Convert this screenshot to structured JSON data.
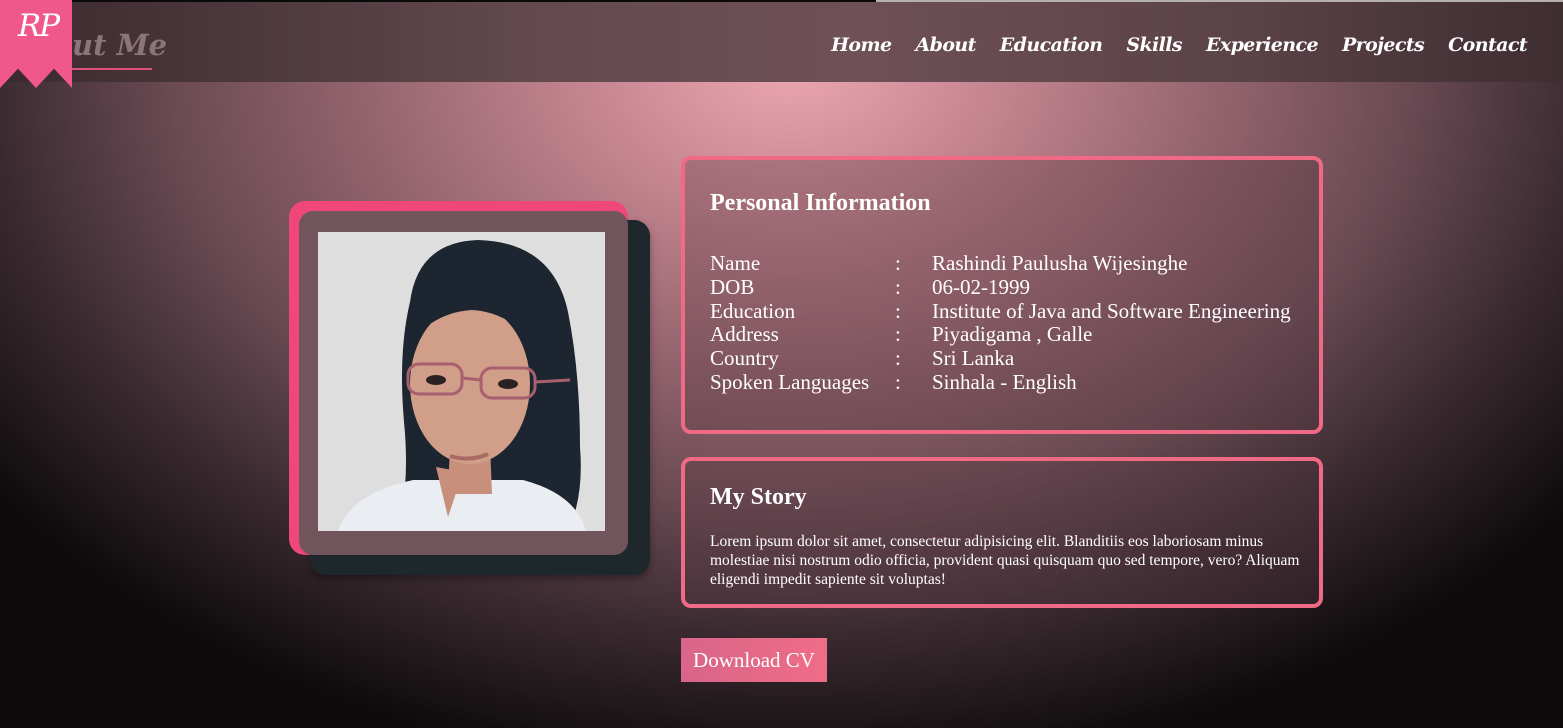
{
  "logo": {
    "text": "RP"
  },
  "header": {
    "page_title": "ut Me"
  },
  "nav": {
    "items": [
      "Home",
      "About",
      "Education",
      "Skills",
      "Experience",
      "Projects",
      "Contact"
    ]
  },
  "personal_info": {
    "title": "Personal Information",
    "rows": [
      {
        "label": "Name",
        "sep": ":",
        "value": "Rashindi Paulusha Wijesinghe"
      },
      {
        "label": "DOB",
        "sep": ":",
        "value": "06-02-1999"
      },
      {
        "label": "Education",
        "sep": ":",
        "value": "Institute of Java and Software Engineering"
      },
      {
        "label": "Address",
        "sep": ":",
        "value": "Piyadigama , Galle"
      },
      {
        "label": "Country",
        "sep": ":",
        "value": "Sri Lanka"
      },
      {
        "label": "Spoken Languages",
        "sep": ":",
        "value": "Sinhala - English"
      }
    ]
  },
  "story": {
    "title": "My Story",
    "text": "Lorem ipsum dolor sit amet, consectetur adipisicing elit. Blanditiis eos laboriosam minus molestiae nisi nostrum odio officia, provident quasi quisquam quo sed tempore, vero? Aliquam eligendi impedit sapiente sit voluptas!"
  },
  "download": {
    "label": "Download CV"
  },
  "colors": {
    "accent": "#f06a86",
    "ribbon": "#f0578a",
    "photo_frame": "#f0477a",
    "navbar": "#644a4f"
  }
}
